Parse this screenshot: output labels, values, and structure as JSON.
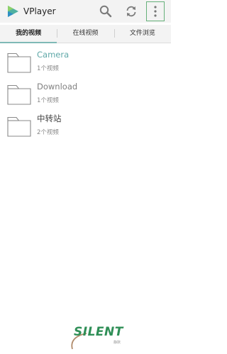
{
  "app": {
    "title": "VPlayer",
    "icons": {
      "logo": "vplayer-logo",
      "search": "search-icon",
      "refresh": "refresh-icon",
      "more": "more-vert-icon"
    }
  },
  "tabs": [
    {
      "label": "我的视频",
      "active": true
    },
    {
      "label": "在线视频",
      "active": false
    },
    {
      "label": "文件浏览",
      "active": false
    }
  ],
  "folders": [
    {
      "name": "Camera",
      "count": "1个视频"
    },
    {
      "name": "Download",
      "count": "1个视频"
    },
    {
      "name": "中转站",
      "count": "2个视频"
    }
  ],
  "watermark": {
    "text": "SILENT",
    "sub": "静默"
  },
  "colors": {
    "accent": "#7fb9b6",
    "highlight_text": "#5fa8a8",
    "bar_bg": "#f3f3f3",
    "watermark": "#2f8f57",
    "focus_outline": "#66b07a"
  }
}
